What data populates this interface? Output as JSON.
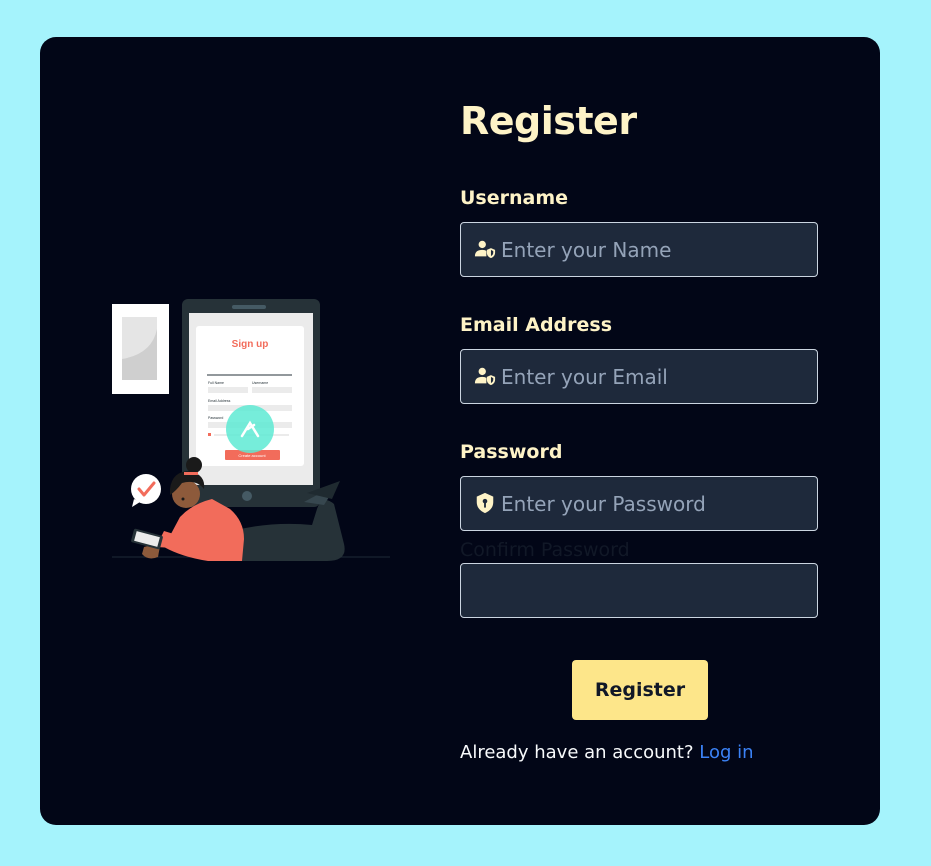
{
  "form": {
    "title": "Register",
    "username": {
      "label": "Username",
      "placeholder": "Enter your Name",
      "icon": "user-shield-icon"
    },
    "email": {
      "label": "Email Address",
      "placeholder": "Enter your Email",
      "icon": "user-shield-icon"
    },
    "password": {
      "label": "Password",
      "placeholder": "Enter your Password",
      "icon": "shield-lock-icon"
    },
    "confirm": {
      "label": "Confirm Password",
      "placeholder": ""
    },
    "submit_label": "Register",
    "footer": {
      "text": "Already have an account?",
      "link": "Log in"
    }
  },
  "illustration": {
    "heading": "Sign up",
    "field_labels": [
      "Full Name",
      "Username",
      "Email Address",
      "Password"
    ],
    "button": "Create account"
  },
  "colors": {
    "page_bg": "#a5f3fc",
    "card_bg": "#020617",
    "text_accent": "#fef3c7",
    "input_bg": "#1e293b",
    "button_bg": "#fde68a",
    "link": "#3b82f6"
  }
}
